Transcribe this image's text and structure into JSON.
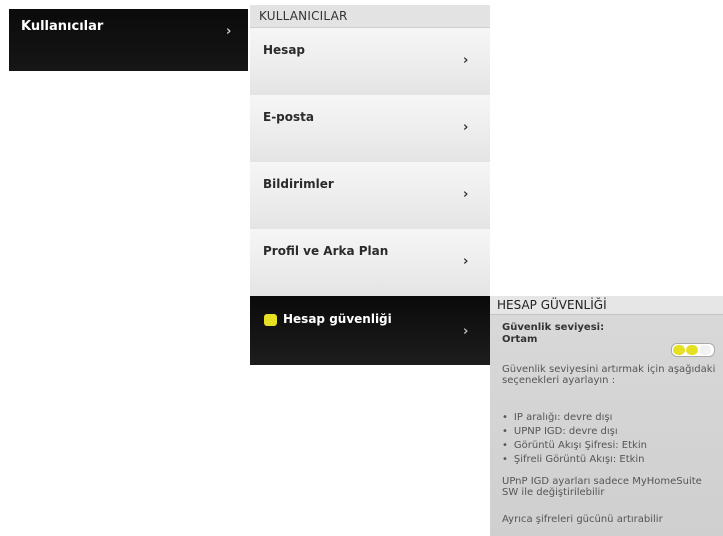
{
  "left_nav": {
    "label": "Kullanıcılar",
    "chevron": "›"
  },
  "middle": {
    "header": "KULLANICILAR",
    "items": [
      {
        "label": "Hesap",
        "chevron": "›"
      },
      {
        "label": "E-posta",
        "chevron": "›"
      },
      {
        "label": "Bildirimler",
        "chevron": "›"
      },
      {
        "label": "Profil ve Arka Plan",
        "chevron": "›"
      },
      {
        "label": "Hesap güvenliği",
        "chevron": "›",
        "status_icon": "yellow-dot-icon"
      }
    ]
  },
  "info": {
    "header": "HESAP GÜVENLİĞİ",
    "level_label": "Güvenlik seviyesi:",
    "level_value": "Ortam",
    "level_segments_filled": 2,
    "level_segments_total": 3,
    "colors": {
      "accent": "#e6e024",
      "empty": "#f2f2f2"
    },
    "intro": "Güvenlik seviyesini artırmak için aşağıdaki seçenekleri ayarlayın :",
    "bullets": [
      "IP aralığı: devre dışı",
      "UPNP IGD: devre dışı",
      "Görüntü Akışı Şifresi: Etkin",
      "Şifreli Görüntü Akışı: Etkin"
    ],
    "note": "UPnP IGD ayarları sadece MyHomeSuite SW ile değiştirilebilir",
    "footer": "Ayrıca şifreleri gücünü artırabilir"
  }
}
